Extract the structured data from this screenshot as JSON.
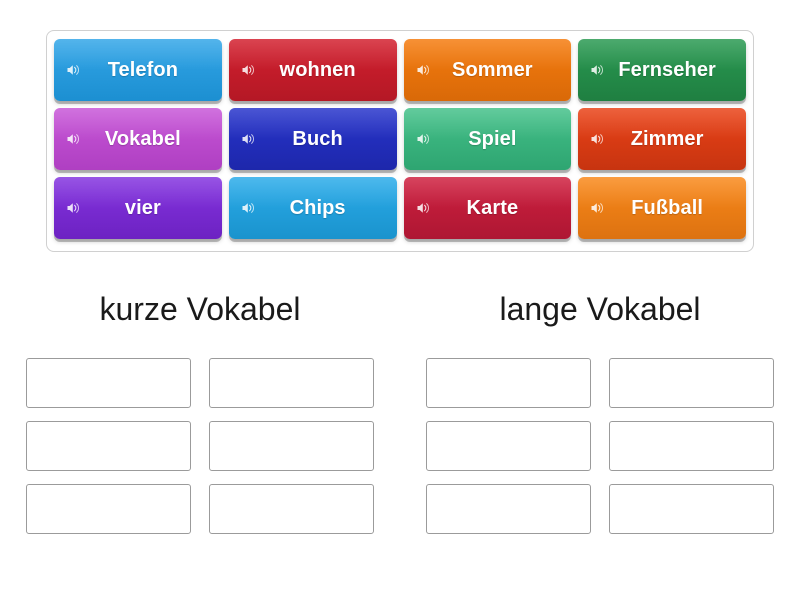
{
  "activity": {
    "type": "group-sort",
    "icon_name": "speaker-icon"
  },
  "word_bank": {
    "rows": [
      [
        {
          "label": "Telefon",
          "color": "#33a6e8",
          "color_dark": "#1c8fd1"
        },
        {
          "label": "wohnen",
          "color": "#d3202f",
          "color_dark": "#b41825"
        },
        {
          "label": "Sommer",
          "color": "#f57c0f",
          "color_dark": "#d96908"
        },
        {
          "label": "Fernseher",
          "color": "#2a9a52",
          "color_dark": "#1f7f41"
        }
      ],
      [
        {
          "label": "Vokabel",
          "color": "#c857d8",
          "color_dark": "#af3fc2"
        },
        {
          "label": "Buch",
          "color": "#2835cc",
          "color_dark": "#1d27ab"
        },
        {
          "label": "Spiel",
          "color": "#45c18a",
          "color_dark": "#2ea571"
        },
        {
          "label": "Zimmer",
          "color": "#ea4318",
          "color_dark": "#c73410"
        }
      ],
      [
        {
          "label": "vier",
          "color": "#8434e0",
          "color_dark": "#6d22c2"
        },
        {
          "label": "Chips",
          "color": "#2bacea",
          "color_dark": "#1a93cd"
        },
        {
          "label": "Karte",
          "color": "#cf2040",
          "color_dark": "#ae1733"
        },
        {
          "label": "Fußball",
          "color": "#f9891b",
          "color_dark": "#dd7210"
        }
      ]
    ]
  },
  "categories": [
    {
      "title": "kurze Vokabel",
      "slots": [
        "",
        "",
        "",
        "",
        "",
        ""
      ]
    },
    {
      "title": "lange Vokabel",
      "slots": [
        "",
        "",
        "",
        "",
        "",
        ""
      ]
    }
  ]
}
